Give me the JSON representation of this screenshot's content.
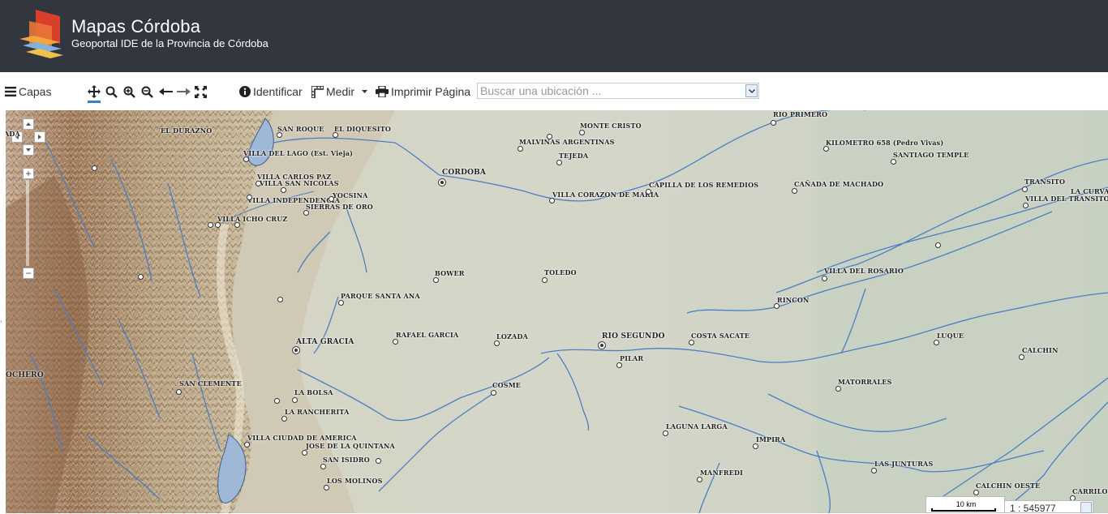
{
  "header": {
    "title": "Mapas Córdoba",
    "subtitle": "Geoportal IDE de la Provincia de Córdoba",
    "bg_color": "#32373f"
  },
  "toolbar": {
    "layers_label": "Capas",
    "identify_label": "Identificar",
    "measure_label": "Medir",
    "print_label": "Imprimir Página",
    "tools": [
      "pan-icon",
      "search-icon",
      "zoom-in-icon",
      "zoom-out-icon",
      "arrow-left-icon",
      "arrow-right-icon",
      "full-extent-icon"
    ],
    "active_tool": "pan-icon",
    "accent_color": "#3a7fc0"
  },
  "search": {
    "placeholder": "Buscar una ubicación ...",
    "value": ""
  },
  "map": {
    "labels": {
      "el_durazno": "EL DURAZNO",
      "san_roque": "SAN ROQUE",
      "el_diquesito": "EL DIQUESITO",
      "villa_del_lago": "VILLA DEL LAGO (Est. Vieja)",
      "villa_carlos_paz": "VILLA CARLOS PAZ",
      "villa_san_nicolas": "VILLA SAN NICOLAS",
      "villa_independencia": "VILLA INDEPENDENCIA",
      "yocsina": "YOCSINA",
      "sierras_de_oro": "SIERRAS DE ORO",
      "villa_icho_cruz": "VILLA ICHO CRUZ",
      "cordoba": "CORDOBA",
      "monte_cristo": "MONTE CRISTO",
      "malvinas_argentinas": "MALVINAS ARGENTINAS",
      "tejeda": "TEJEDA",
      "villa_corazon_de_maria": "VILLA CORAZON DE MARIA",
      "capilla_de_los_remedios": "CAPILLA DE LOS REMEDIOS",
      "rio_primero": "RIO PRIMERO",
      "kilometro_658": "KILOMETRO 658 (Pedro Vivas)",
      "santiago_temple": "SANTIAGO TEMPLE",
      "canada_de_machado": "CAÑADA DE MACHADO",
      "transito": "TRANSITO",
      "la_curva": "LA CURVA",
      "villa_del_transito": "VILLA DEL TRANSITO",
      "bower": "BOWER",
      "toledo": "TOLEDO",
      "villa_del_rosario": "VILLA DEL ROSARIO",
      "rincon": "RINCON",
      "parque_santa_ana": "PARQUE SANTA ANA",
      "rafael_garcia": "RAFAEL GARCIA",
      "lozada": "LOZADA",
      "rio_segundo": "RIO SEGUNDO",
      "costa_sacate": "COSTA SACATE",
      "luque": "LUQUE",
      "calchin": "CALCHIN",
      "alta_gracia": "ALTA GRACIA",
      "pilar": "PILAR",
      "ochero": "OCHERO",
      "san_clemente": "SAN CLEMENTE",
      "cosme": "COSME",
      "matorrales": "MATORRALES",
      "la_bolsa": "LA BOLSA",
      "la_rancherita": "LA RANCHERITA",
      "laguna_larga": "LAGUNA LARGA",
      "villa_ciudad_de_america": "VILLA CIUDAD DE AMERICA",
      "jose_de_la_quintana": "JOSE DE LA QUINTANA",
      "impira": "IMPIRA",
      "san_isidro": "SAN ISIDRO",
      "las_junturas": "LAS JUNTURAS",
      "manfredi": "MANFREDI",
      "los_molinos": "LOS MOLINOS",
      "calchin_oeste": "CALCHIN OESTE",
      "carrilobo": "CARRILOB",
      "ada": "ADA"
    },
    "scale_label": "10 km",
    "scale_ratio": "1 : 545977",
    "river_color": "#4a7fc4",
    "lake_color": "#9fb8d8"
  }
}
